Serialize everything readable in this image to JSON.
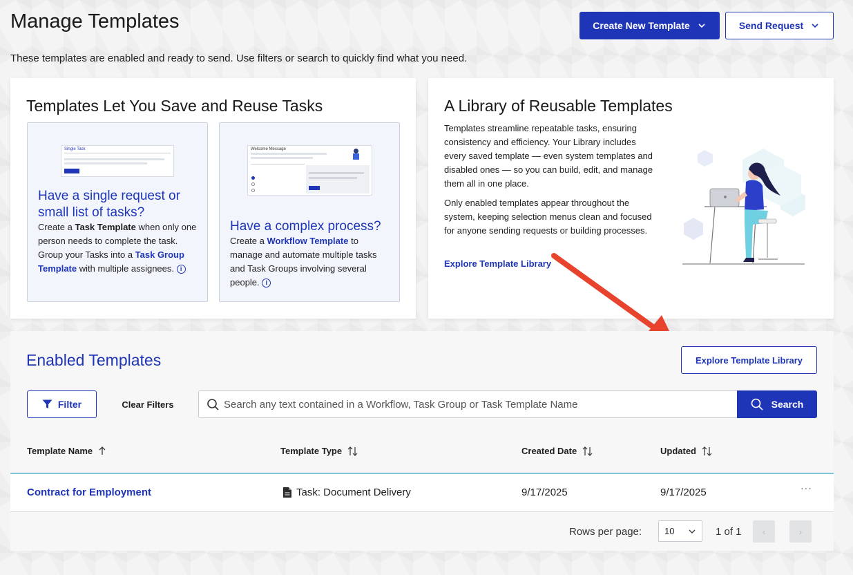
{
  "header": {
    "title": "Manage Templates",
    "subtitle": "These templates are enabled and ready to send. Use filters or search to quickly find what you need.",
    "create_button": "Create New Template",
    "send_button": "Send Request"
  },
  "save_card": {
    "title": "Templates Let You Save and Reuse Tasks",
    "single": {
      "thumb_label": "Single Task",
      "heading": "Have a single request or small list of tasks?",
      "text_1": "Create a ",
      "link_1": "Task Template",
      "text_2": " when only one person needs to complete the task. Group your Tasks into a ",
      "link_2": "Task Group Template",
      "text_3": " with multiple assignees."
    },
    "complex": {
      "thumb_label": "Welcome Message",
      "heading": "Have a complex process?",
      "text_1": "Create a ",
      "link_1": "Workflow Template",
      "text_2": " to manage and automate multiple tasks and Task Groups involving several people."
    }
  },
  "library_card": {
    "title": "A Library of Reusable Templates",
    "para_1": "Templates streamline repeatable tasks, ensuring consistency and efficiency. Your Library includes every saved template — even system templates and disabled ones — so you can build, edit, and manage them all in one place.",
    "para_2": "Only enabled templates appear throughout the system, keeping selection menus clean and focused for anyone sending requests or building processes.",
    "link": "Explore Template Library"
  },
  "enabled": {
    "title": "Enabled Templates",
    "explore_button": "Explore Template Library",
    "filter_button": "Filter",
    "clear_filters": "Clear Filters",
    "search_placeholder": "Search any text contained in a Workflow, Task Group or Task Template Name",
    "search_button": "Search",
    "columns": {
      "name": "Template Name",
      "type": "Template Type",
      "created": "Created Date",
      "updated": "Updated"
    },
    "rows": [
      {
        "name": "Contract for Employment",
        "type": "Task: Document Delivery",
        "created": "9/17/2025",
        "updated": "9/17/2025",
        "actions": "···"
      }
    ],
    "pagination": {
      "rows_label": "Rows per page:",
      "rows_value": "10",
      "count": "1 of 1",
      "prev": "‹",
      "next": "›"
    }
  },
  "colors": {
    "brand": "#1f35b8",
    "accent_teal": "#7fc6d7",
    "arrow": "#e8432d"
  },
  "icons": [
    "chevron-down-icon",
    "info-icon",
    "filter-icon",
    "search-icon",
    "sort-asc-icon",
    "sort-icon",
    "document-icon",
    "more-icon"
  ]
}
